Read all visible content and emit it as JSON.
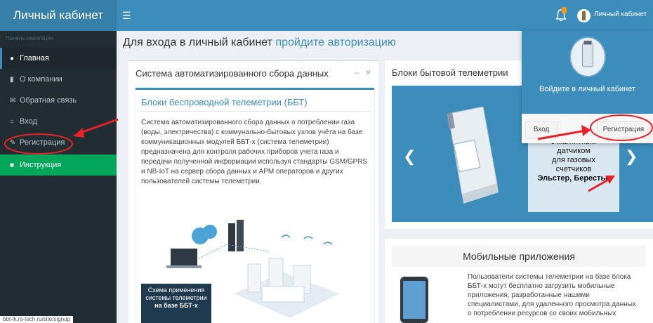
{
  "header": {
    "logo": "Личный кабинет",
    "menu_icon": "hamburger-icon",
    "user_name": "Личный кабинет"
  },
  "sidebar": {
    "header": "Панель навигации",
    "items": [
      {
        "label": "Главная",
        "icon": "dashboard-icon"
      },
      {
        "label": "О компании",
        "icon": "bookmark-icon"
      },
      {
        "label": "Обратная связь",
        "icon": "envelope-icon"
      },
      {
        "label": "Вход",
        "icon": "circle-icon"
      },
      {
        "label": "Регистрация",
        "icon": "pencil-icon"
      },
      {
        "label": "Инструкция",
        "icon": "file-icon"
      }
    ]
  },
  "main": {
    "heading_prefix": "Для входа в личный кабинет ",
    "heading_link": "пройдите авторизацию"
  },
  "left_box": {
    "title": "Система автоматизированного сбора данных",
    "tools": "– ×",
    "inner_title": "Блоки беспроводной телеметрии (ББТ)",
    "text": "Система автоматизированного сбора данных о потреблении газа (воды, электричества) с коммунально-бытовых узлов учёта на базе коммуникационных модулей ББТ-х (система телеметрии) предназначена для контроля рабочих приборов учета газа и передачи полученной информации используя стандарты GSM/GPRS и NB-IoT на сервер сбора данных и АРМ операторов и других пользователей системы телеметрии.",
    "scheme_caption_1": "Схема применения",
    "scheme_caption_2": "системы телеметрии",
    "scheme_caption_3": "на базе ББТ-х"
  },
  "telemetry_box": {
    "title": "Блоки бытовой телеметрии",
    "slide_lines": [
      "с магнитным",
      "датчиком",
      "для газовых",
      "счетчиков"
    ],
    "slide_bold": "Эльстер, Берестье"
  },
  "popup": {
    "text": "Войдите в личный кабинет",
    "login_button": "Вход",
    "register_button": "Регистрация"
  },
  "mobile_box": {
    "title": "Мобильные приложения",
    "text": "Пользователи системы телеметрии на базе блока ББТ-х могут бесплатно загрузить мобильные приложения, разработанные нашими специалистами, для удаленного просмотра данных о потреблении ресурсов со своих мобильных"
  },
  "status_bar": {
    "url": "bbt-lk.rs-tech.ru/site/signup"
  },
  "colors": {
    "primary": "#3c8dbc",
    "sidebar": "#222d32",
    "success": "#00a65a",
    "annotation": "#e8202a"
  }
}
